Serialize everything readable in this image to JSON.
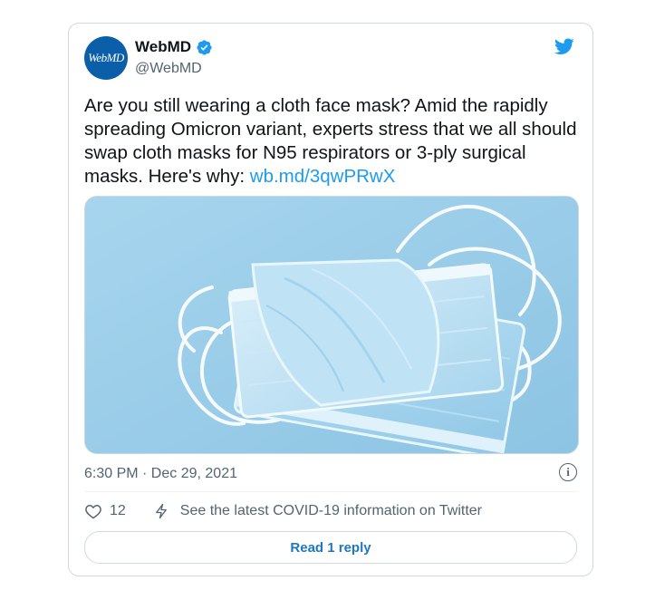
{
  "author": {
    "avatar_text": "WebMD",
    "name": "WebMD",
    "handle": "@WebMD",
    "avatar_color": "#0a5fa8"
  },
  "tweet": {
    "text": "Are you still wearing a cloth face mask? Amid the rapidly spreading Omicron variant, experts stress that we all should swap cloth masks for N95 respirators or 3-ply surgical masks. Here's why: ",
    "link": "wb.md/3qwPRwX",
    "timestamp": "6:30 PM · Dec 29, 2021",
    "image_icon": "surgical-masks-photo"
  },
  "actions": {
    "like_count": "12",
    "covid_label": "See the latest COVID-19 information on Twitter",
    "reply_label": "Read 1 reply"
  },
  "icons": {
    "brand": "twitter-bird-icon",
    "info": "info-icon",
    "like": "heart-icon",
    "covid": "lightning-icon"
  },
  "colors": {
    "accent": "#1d9bf0",
    "muted": "#536471",
    "border": "#cfd9de"
  }
}
